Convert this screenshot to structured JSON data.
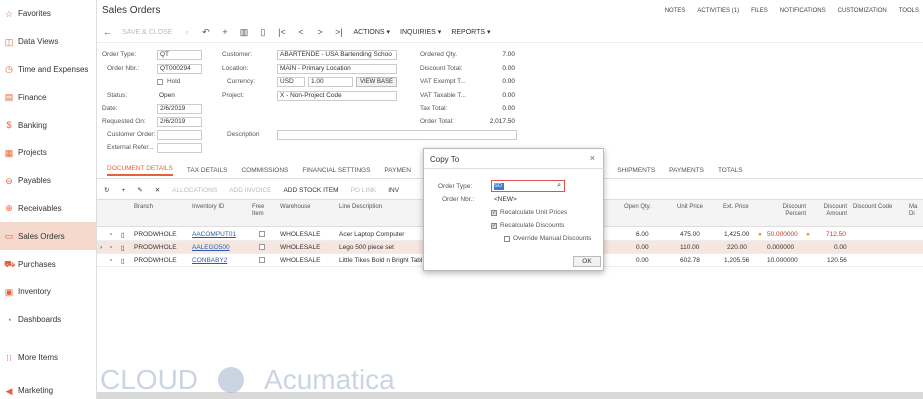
{
  "sidebar": {
    "items": [
      {
        "label": "Favorites",
        "icon": "star-icon"
      },
      {
        "label": "Data Views",
        "icon": "data-views-icon"
      },
      {
        "label": "Time and Expenses",
        "icon": "clock-icon"
      },
      {
        "label": "Finance",
        "icon": "finance-icon"
      },
      {
        "label": "Banking",
        "icon": "dollar-icon"
      },
      {
        "label": "Projects",
        "icon": "projects-icon"
      },
      {
        "label": "Payables",
        "icon": "payables-icon"
      },
      {
        "label": "Receivables",
        "icon": "receivables-icon"
      },
      {
        "label": "Sales Orders",
        "icon": "cart-icon"
      },
      {
        "label": "Purchases",
        "icon": "purchases-icon"
      },
      {
        "label": "Inventory",
        "icon": "inventory-icon"
      },
      {
        "label": "Dashboards",
        "icon": "dashboards-icon"
      }
    ],
    "more": "More Items",
    "marketing": "Marketing"
  },
  "header": {
    "title": "Sales Orders",
    "links": [
      "NOTES",
      "ACTIVITIES (1)",
      "FILES",
      "NOTIFICATIONS",
      "CUSTOMIZATION",
      "TOOLS"
    ]
  },
  "toolbar": {
    "save_close": "SAVE & CLOSE",
    "actions": "ACTIONS",
    "inquiries": "INQUIRIES",
    "reports": "REPORTS"
  },
  "form": {
    "order_type_label": "Order Type:",
    "order_type": "QT",
    "order_nbr_label": "Order Nbr.:",
    "order_nbr": "QT000294",
    "hold_label": "Hold",
    "status_label": "Status:",
    "status": "Open",
    "date_label": "Date:",
    "date": "2/6/2019",
    "requested_on_label": "Requested On:",
    "requested_on": "2/6/2019",
    "customer_order_label": "Customer Order:",
    "external_ref_label": "External Refer...",
    "customer_label": "Customer:",
    "customer": "ABARTENDE - USA Bartending Schoo",
    "location_label": "Location:",
    "location": "MAIN - Primary Location",
    "currency_label": "Currency:",
    "currency": "USD",
    "rate": "1.00",
    "view_base": "VIEW BASE",
    "project_label": "Project:",
    "project": "X - Non-Project Code",
    "description_label": "Description",
    "ordered_qty_label": "Ordered Qty.",
    "ordered_qty": "7.00",
    "discount_total_label": "Discount Total:",
    "discount_total": "0.00",
    "vat_exempt_label": "VAT Exempt T...",
    "vat_exempt": "0.00",
    "vat_taxable_label": "VAT Taxable T...",
    "vat_taxable": "0.00",
    "tax_total_label": "Tax Total:",
    "tax_total": "0.00",
    "order_total_label": "Order Total:",
    "order_total": "2,017.50"
  },
  "tabs": [
    "DOCUMENT DETAILS",
    "TAX DETAILS",
    "COMMISSIONS",
    "FINANCIAL SETTINGS",
    "PAYMEN",
    "TS",
    "SHIPMENTS",
    "PAYMENTS",
    "TOTALS"
  ],
  "gridbar": {
    "allocations": "ALLOCATIONS",
    "add_invoice": "ADD INVOICE",
    "add_stock_item": "ADD STOCK ITEM",
    "po_link": "PO LINK",
    "inv": "INV"
  },
  "grid": {
    "headers": {
      "branch": "Branch",
      "inventory_id": "Inventory ID",
      "free_item": "Free Item",
      "warehouse": "Warehouse",
      "line_description": "Line Description",
      "open_qty": "Open Qty.",
      "unit_price": "Unit Price",
      "ext_price": "Ext. Price",
      "discount_percent": "Discount Percent",
      "discount_amount": "Discount Amount",
      "discount_code": "Discount Code",
      "manual": "Ma Di"
    },
    "rows": [
      {
        "branch": "PRODWHOLE",
        "inventory_id": "AACOMPUT01",
        "warehouse": "WHOLESALE",
        "description": "Acer Laptop Computer",
        "open_qty": "6.00",
        "unit_price": "475.00",
        "ext_price": "1,425.00",
        "discount_percent": "50.000000",
        "discount_amount": "712.50"
      },
      {
        "branch": "PRODWHOLE",
        "inventory_id": "AALEGO500",
        "warehouse": "WHOLESALE",
        "description": "Lego 500 piece set",
        "open_qty": "0.00",
        "unit_price": "110.00",
        "ext_price": "220.00",
        "discount_percent": "0.000000",
        "discount_amount": "0.00"
      },
      {
        "branch": "PRODWHOLE",
        "inventory_id": "CONBABY2",
        "warehouse": "WHOLESALE",
        "description": "Little Tikes Bold n Bright Tabl",
        "open_qty": "0.00",
        "unit_price": "602.78",
        "ext_price": "1,205.56",
        "discount_percent": "10.000000",
        "discount_amount": "120.56"
      }
    ]
  },
  "dialog": {
    "title": "Copy To",
    "order_type_label": "Order Type:",
    "order_type_value": "SO",
    "order_nbr_label": "Order Nbr.:",
    "order_nbr_value": "<NEW>",
    "recalc_prices": "Recalculate Unit Prices",
    "recalc_discounts": "Recalculate Discounts",
    "override_manual": "Override Manual Discounts",
    "ok": "OK"
  },
  "watermark": {
    "left": "CLOUD",
    "right": "Acumatica"
  },
  "colors": {
    "accent": "#e8613a",
    "link": "#2a5db0",
    "selected_row": "#f6e6e0"
  }
}
